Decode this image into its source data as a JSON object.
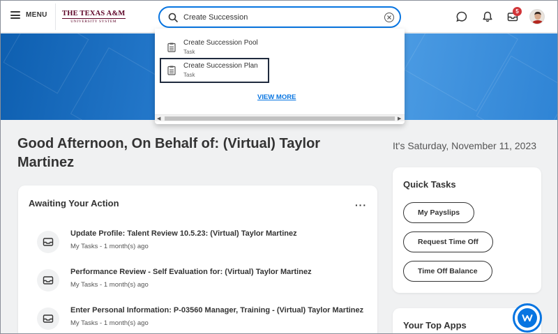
{
  "header": {
    "menu_label": "MENU",
    "logo_top": "THE TEXAS A&M",
    "logo_bottom": "UNIVERSITY SYSTEM",
    "inbox_badge": "5"
  },
  "search": {
    "value": "Create Succession",
    "results": [
      {
        "title": "Create Succession Pool",
        "type": "Task"
      },
      {
        "title": "Create Succession Plan",
        "type": "Task"
      }
    ],
    "view_more": "VIEW MORE"
  },
  "main": {
    "greeting": "Good Afternoon, On Behalf of: (Virtual) Taylor Martinez",
    "date": "It's Saturday, November 11, 2023"
  },
  "awaiting": {
    "title": "Awaiting Your Action",
    "tasks": [
      {
        "title": "Update Profile: Talent Review 10.5.23: (Virtual) Taylor Martinez",
        "meta": "My Tasks - 1 month(s) ago"
      },
      {
        "title": "Performance Review - Self Evaluation for: (Virtual) Taylor Martinez",
        "meta": "My Tasks - 1 month(s) ago"
      },
      {
        "title": "Enter Personal Information: P-03560 Manager, Training - (Virtual) Taylor Martinez",
        "meta": "My Tasks - 1 month(s) ago"
      }
    ]
  },
  "quick_tasks": {
    "title": "Quick Tasks",
    "buttons": [
      "My Payslips",
      "Request Time Off",
      "Time Off Balance"
    ]
  },
  "top_apps": {
    "title": "Your Top Apps"
  },
  "colors": {
    "accent": "#0875e1",
    "badge": "#d13438",
    "brand": "#5c0025"
  }
}
